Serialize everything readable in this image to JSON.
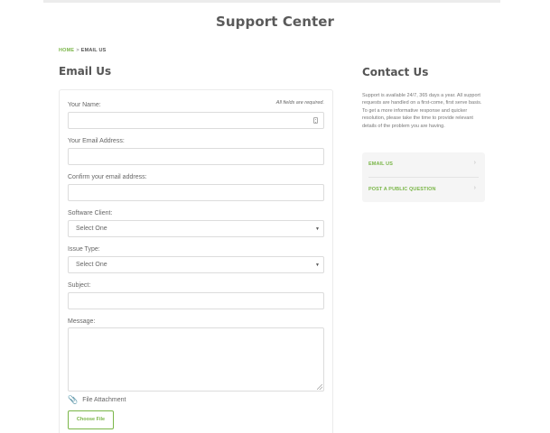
{
  "header": {
    "title": "Support Center"
  },
  "breadcrumb": {
    "home": "HOME",
    "separator": ">",
    "current": "EMAIL US"
  },
  "email_section": {
    "heading": "Email Us",
    "required_note": "All fields are required.",
    "fields": {
      "name_label": "Your Name:",
      "name_value": "",
      "email_label": "Your Email Address:",
      "email_value": "",
      "confirm_label": "Confirm your email address:",
      "confirm_value": "",
      "client_label": "Software Client:",
      "client_selected": "Select One",
      "issue_label": "Issue Type:",
      "issue_selected": "Select One",
      "subject_label": "Subject:",
      "subject_value": "",
      "message_label": "Message:",
      "message_value": ""
    },
    "attachment_label": "File Attachment",
    "choose_file_label": "Choose File",
    "icons": {
      "attach": "paperclip-icon",
      "name_field": "contact-card-icon"
    }
  },
  "contact_section": {
    "heading": "Contact Us",
    "description": "Support is available 24/7, 365 days a year. All support requests are handled on a first-come, first serve basis. To get a more informative response and quicker resolution, please take the time to provide relevant details of the problem you are having.",
    "menu": [
      {
        "label": "EMAIL US"
      },
      {
        "label": "POST A PUBLIC QUESTION"
      }
    ]
  },
  "colors": {
    "accent": "#7ab648",
    "heading": "#5a5a5a",
    "border": "#dcdcdc"
  }
}
